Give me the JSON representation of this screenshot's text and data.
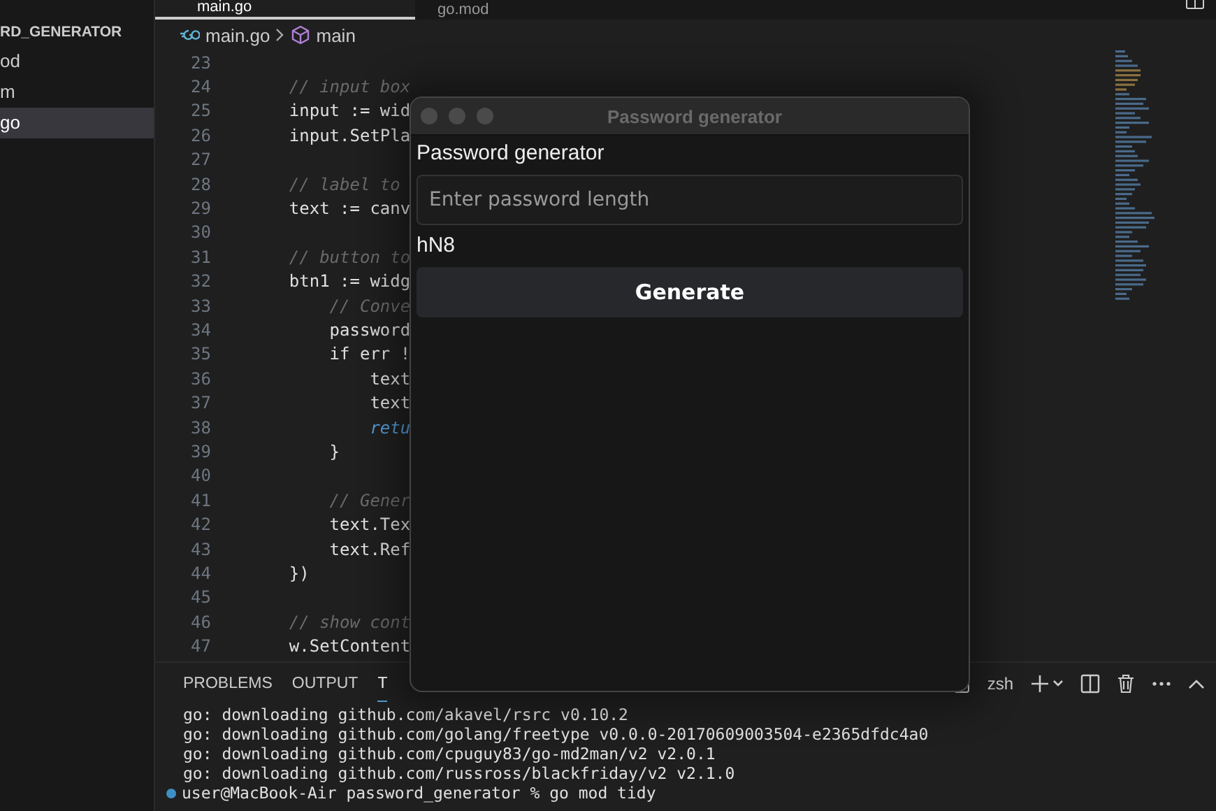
{
  "editor_tabs": [
    {
      "label": "main.go",
      "selected": true
    },
    {
      "label": "go.mod",
      "selected": false
    }
  ],
  "sidebar": {
    "title": "RD_GENERATOR",
    "items": [
      {
        "label": "od",
        "selected": false
      },
      {
        "label": "m",
        "selected": false
      },
      {
        "label": "go",
        "selected": true
      }
    ]
  },
  "breadcrumb": {
    "file": "main.go",
    "symbol": "main"
  },
  "code_lines": [
    {
      "number": "23"
    },
    {
      "number": "24",
      "kind": "comment",
      "text": "    // input box"
    },
    {
      "number": "25",
      "kind": "code",
      "text": "    input := wid"
    },
    {
      "number": "26",
      "kind": "code",
      "text": "    input.SetPla"
    },
    {
      "number": "27"
    },
    {
      "number": "28",
      "kind": "comment",
      "text": "    // label to"
    },
    {
      "number": "29",
      "kind": "code",
      "text": "    text := canv"
    },
    {
      "number": "30"
    },
    {
      "number": "31",
      "kind": "comment",
      "text": "    // button to"
    },
    {
      "number": "32",
      "kind": "code",
      "text": "    btn1 := widg"
    },
    {
      "number": "33",
      "kind": "comment",
      "text": "        // Conve"
    },
    {
      "number": "34",
      "kind": "code",
      "text": "        password"
    },
    {
      "number": "35",
      "kind": "code",
      "text": "        if err !"
    },
    {
      "number": "36",
      "kind": "code",
      "text": "            text"
    },
    {
      "number": "37",
      "kind": "code",
      "text": "            text"
    },
    {
      "number": "38",
      "kind": "keyword",
      "text": "            retu"
    },
    {
      "number": "39",
      "kind": "code",
      "text": "        }"
    },
    {
      "number": "40"
    },
    {
      "number": "41",
      "kind": "comment",
      "text": "        // Gener"
    },
    {
      "number": "42",
      "kind": "code",
      "text": "        text.Tex"
    },
    {
      "number": "43",
      "kind": "code",
      "text": "        text.Ref"
    },
    {
      "number": "44",
      "kind": "code",
      "text": "    })"
    },
    {
      "number": "45"
    },
    {
      "number": "46",
      "kind": "comment",
      "text": "    // show cont"
    },
    {
      "number": "47",
      "kind": "code",
      "text": "    w.SetContent"
    }
  ],
  "dialog": {
    "title": "Password generator",
    "label": "Password generator",
    "input": {
      "placeholder": "Enter password length"
    },
    "output": "hN8",
    "button": "Generate"
  },
  "panel": {
    "tabs": [
      {
        "label": "PROBLEMS",
        "selected": false
      },
      {
        "label": "OUTPUT",
        "selected": false
      },
      {
        "label": "T",
        "selected": true
      }
    ],
    "shell": "zsh",
    "lines": [
      "go: downloading github.com/akavel/rsrc v0.10.2",
      "go: downloading github.com/golang/freetype v0.0.0-20170609003504-e2365dfdc4a0",
      "go: downloading github.com/cpuguy83/go-md2man/v2 v2.0.1",
      "go: downloading github.com/russross/blackfriday/v2 v2.1.0"
    ],
    "prompt": "user@MacBook-Air password_generator % go mod tidy"
  }
}
